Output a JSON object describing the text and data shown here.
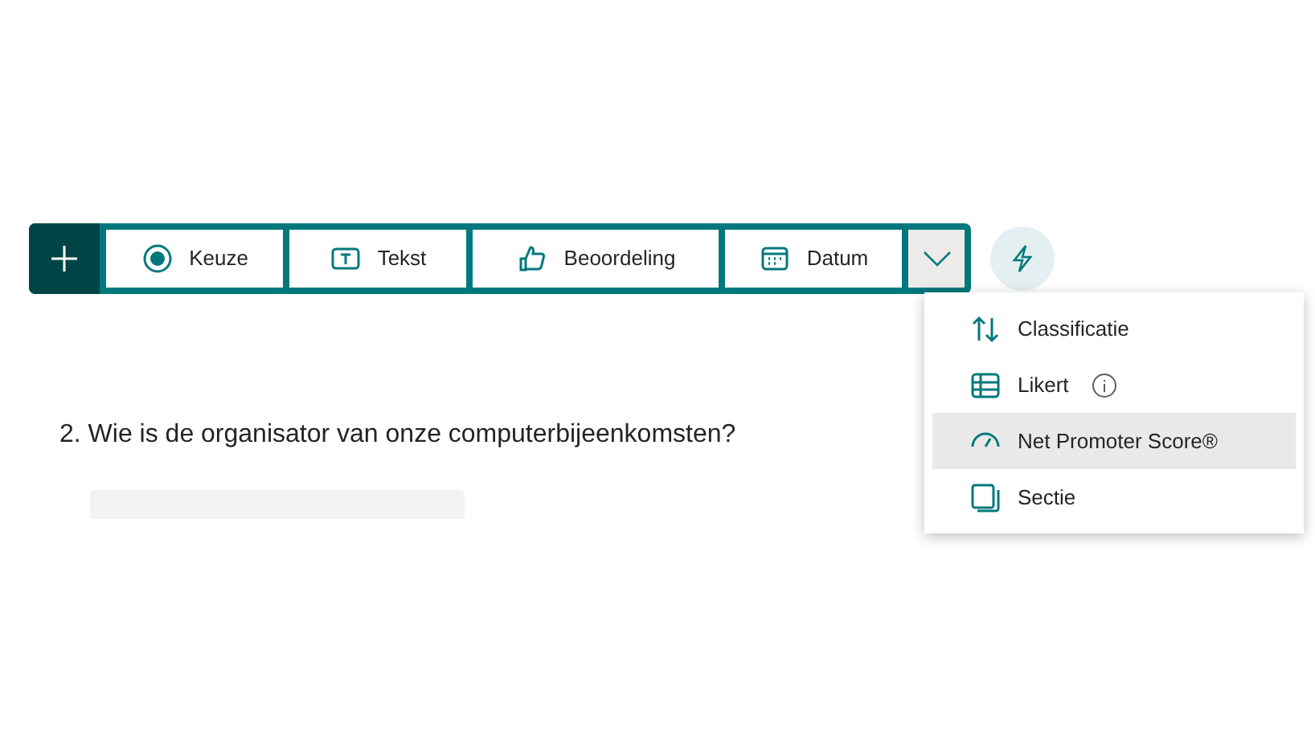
{
  "toolbar": {
    "items": [
      {
        "kind": "choice",
        "label": "Keuze"
      },
      {
        "kind": "text",
        "label": "Tekst"
      },
      {
        "kind": "rating",
        "label": "Beoordeling"
      },
      {
        "kind": "date",
        "label": "Datum"
      }
    ],
    "more_expanded": true
  },
  "menu": {
    "items": [
      {
        "kind": "ranking",
        "label": "Classificatie",
        "selected": false,
        "info": false
      },
      {
        "kind": "likert",
        "label": "Likert",
        "selected": false,
        "info": true
      },
      {
        "kind": "nps",
        "label": "Net Promoter Score®",
        "selected": true,
        "info": false
      },
      {
        "kind": "section",
        "label": "Sectie",
        "selected": false,
        "info": false
      }
    ]
  },
  "question": {
    "title": "2. Wie is de organisator van onze computerbijeenkomsten?"
  }
}
